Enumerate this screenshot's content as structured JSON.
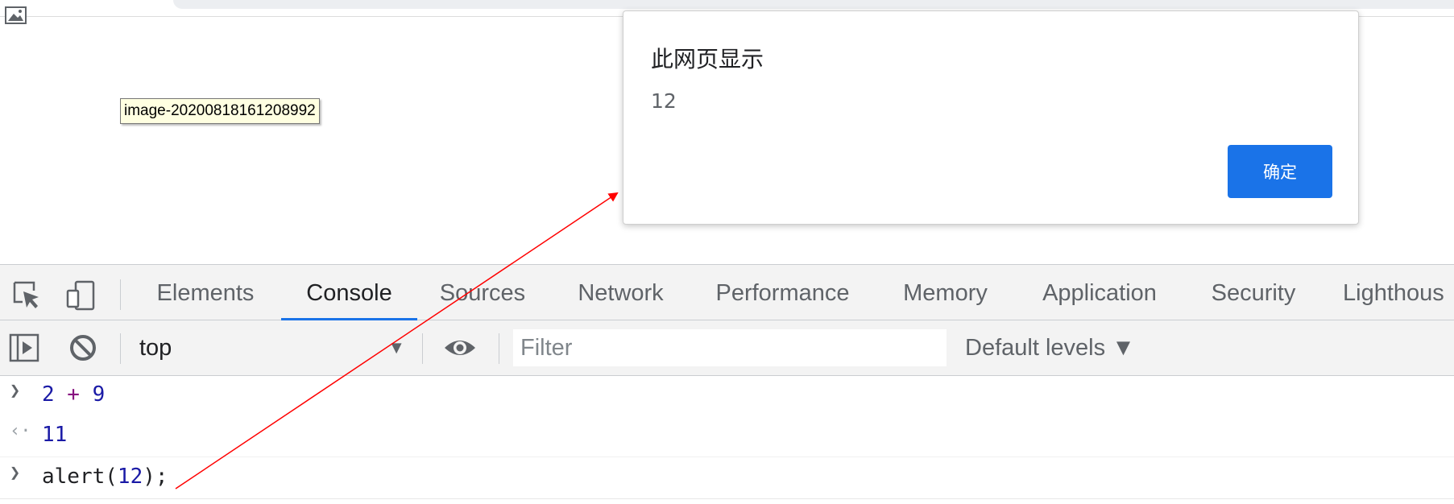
{
  "page": {
    "broken_image_icon": "image-placeholder-icon",
    "tooltip_text": "image-20200818161208992"
  },
  "dialog": {
    "title": "此网页显示",
    "message": "12",
    "ok_label": "确定"
  },
  "devtools": {
    "tabs": [
      {
        "label": "Elements",
        "active": false
      },
      {
        "label": "Console",
        "active": true
      },
      {
        "label": "Sources",
        "active": false
      },
      {
        "label": "Network",
        "active": false
      },
      {
        "label": "Performance",
        "active": false
      },
      {
        "label": "Memory",
        "active": false
      },
      {
        "label": "Application",
        "active": false
      },
      {
        "label": "Security",
        "active": false
      },
      {
        "label": "Lighthous",
        "active": false
      }
    ],
    "toolbar": {
      "context": "top",
      "filter_placeholder": "Filter",
      "levels_label": "Default levels ▼"
    },
    "console": [
      {
        "type": "input",
        "tokens": [
          [
            "num",
            "2"
          ],
          [
            "op",
            " + "
          ],
          [
            "num",
            "9"
          ]
        ]
      },
      {
        "type": "output",
        "text": "11"
      },
      {
        "type": "input",
        "tokens": [
          [
            "plain",
            "alert("
          ],
          [
            "num",
            "12"
          ],
          [
            "plain",
            ");"
          ]
        ]
      }
    ]
  },
  "colors": {
    "accent": "#1a73e8",
    "annotation_arrow": "#ff0000",
    "console_number": "#1a1aa6"
  }
}
